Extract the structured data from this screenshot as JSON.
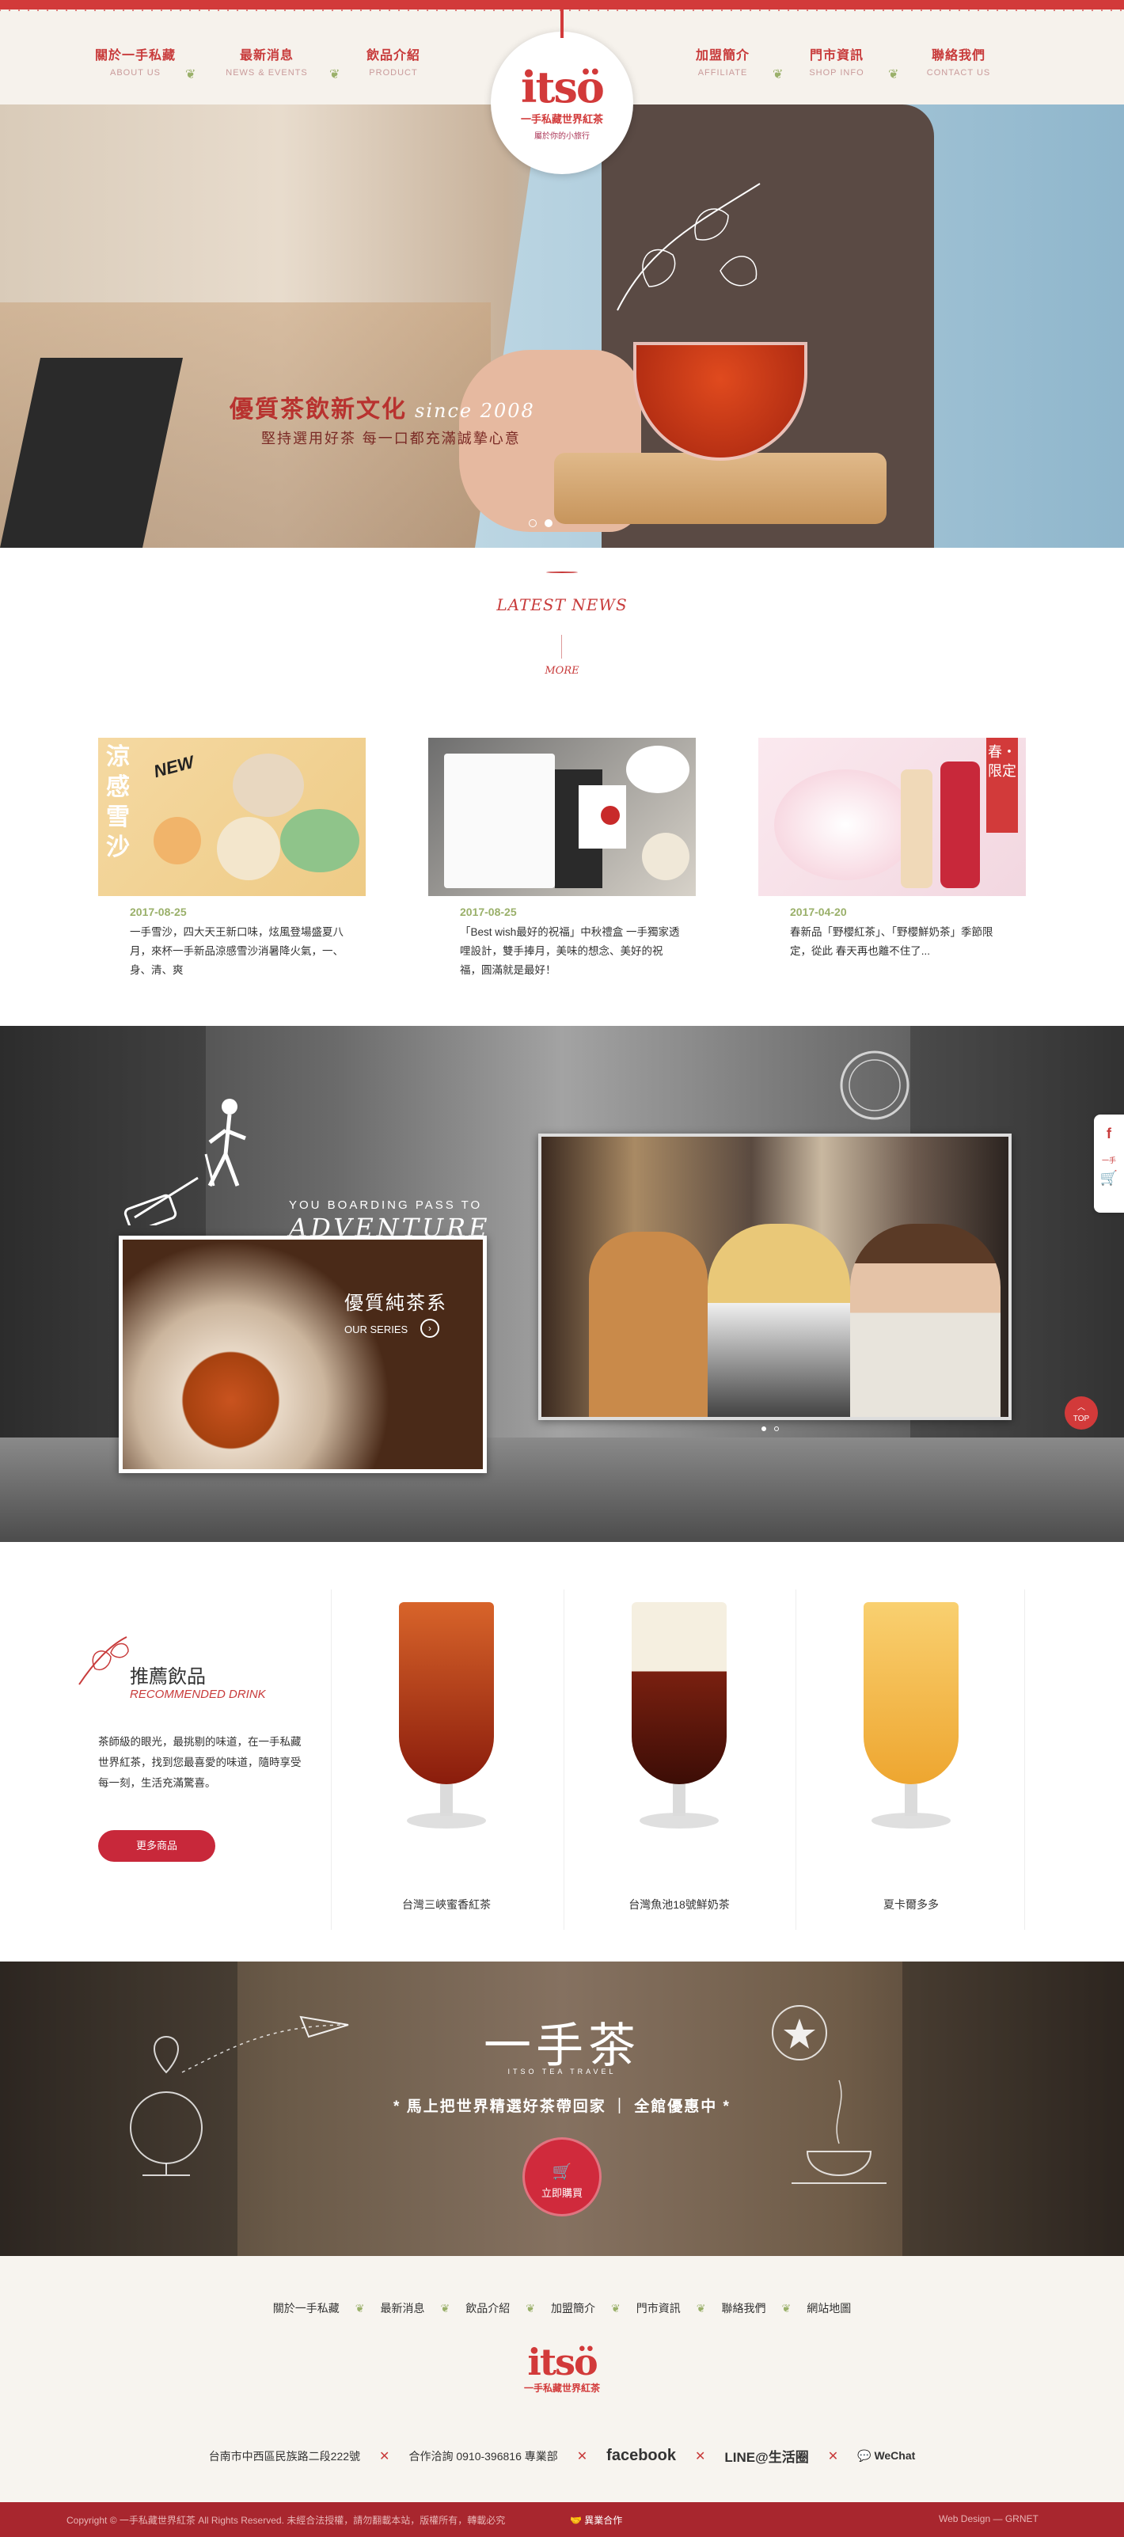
{
  "header": {
    "nav_left": [
      {
        "zh": "關於一手私藏",
        "en": "ABOUT US"
      },
      {
        "zh": "最新消息",
        "en": "NEWS & EVENTS"
      },
      {
        "zh": "飲品介紹",
        "en": "PRODUCT"
      }
    ],
    "nav_right": [
      {
        "zh": "加盟簡介",
        "en": "AFFILIATE"
      },
      {
        "zh": "門市資訊",
        "en": "SHOP INFO"
      },
      {
        "zh": "聯絡我們",
        "en": "CONTACT US"
      }
    ],
    "logo": {
      "main": "itsö",
      "sub": "一手私藏世界紅茶",
      "tag": "屬於你的小旅行"
    }
  },
  "hero": {
    "title": "優質茶飲新文化",
    "since": "since 2008",
    "subtitle": "堅持選用好茶 每一口都充滿誠摯心意",
    "slides": 2,
    "active_slide": 2
  },
  "news": {
    "title": "LATEST NEWS",
    "more": "MORE",
    "items": [
      {
        "date": "2017-08-25",
        "text": "一手雪沙，四大天王新口味，炫風登場盛夏八月，來杯一手新品涼感雪沙消暑降火氣，一、身、清、爽",
        "img_label": "涼感雪沙"
      },
      {
        "date": "2017-08-25",
        "text": "「Best wish最好的祝福」中秋禮盒 一手獨家透哩設計，雙手捧月，美味的想念、美好的祝福，圓滿就是最好！",
        "img_label": ""
      },
      {
        "date": "2017-04-20",
        "text": "春新品「野櫻紅茶」、「野櫻鮮奶茶」季節限定，從此 春天再也離不住了...",
        "img_label": "春・限定"
      }
    ]
  },
  "adventure": {
    "caption_small": "YOU BOARDING PASS TO",
    "caption_big": "ADVENTURE",
    "tea_title": "優質純茶系",
    "tea_sub": "OUR SERIES",
    "top_label": "TOP"
  },
  "side_social": {
    "fb": "f",
    "text": "一手",
    "cart": "🛒"
  },
  "recommended": {
    "zh": "推薦飲品",
    "en": "RECOMMENDED DRINK",
    "desc": "茶師級的眼光，最挑剔的味道，在一手私藏世界紅茶，找到您最喜愛的味道，隨時享受每一刻，生活充滿驚喜。",
    "button": "更多商品",
    "drinks": [
      {
        "name": "台灣三峽蜜香紅茶",
        "color": "#b83a18"
      },
      {
        "name": "台灣魚池18號鮮奶茶",
        "color": "#5a1a10"
      },
      {
        "name": "夏卡爾多多",
        "color": "#f0b640"
      }
    ]
  },
  "banner": {
    "title": "一手茶",
    "sub": "ITSO TEA TRAVEL",
    "slogan": "* 馬上把世界精選好茶帶回家 ｜ 全館優惠中 *",
    "button": "立即購買"
  },
  "footer": {
    "nav": [
      "關於一手私藏",
      "最新消息",
      "飲品介紹",
      "加盟簡介",
      "門市資訊",
      "聯絡我們",
      "網站地圖"
    ],
    "logo": {
      "main": "itsö",
      "sub": "一手私藏世界紅茶"
    },
    "address": "台南市中西區民族路二段222號",
    "phone": "合作洽詢 0910-396816 專業部",
    "facebook": "facebook",
    "line": "LINE@生活圈",
    "wechat": "WeChat",
    "copyright": "Copyright © 一手私藏世界紅茶 All Rights Reserved. 未經合法授權，請勿翻載本站，版權所有，轉載必究",
    "partner": "異業合作",
    "design": "Web Design  —  GRNET"
  },
  "colors": {
    "brand_red": "#d23a3a",
    "leaf_green": "#9ab06a",
    "button_red": "#c8283a"
  }
}
